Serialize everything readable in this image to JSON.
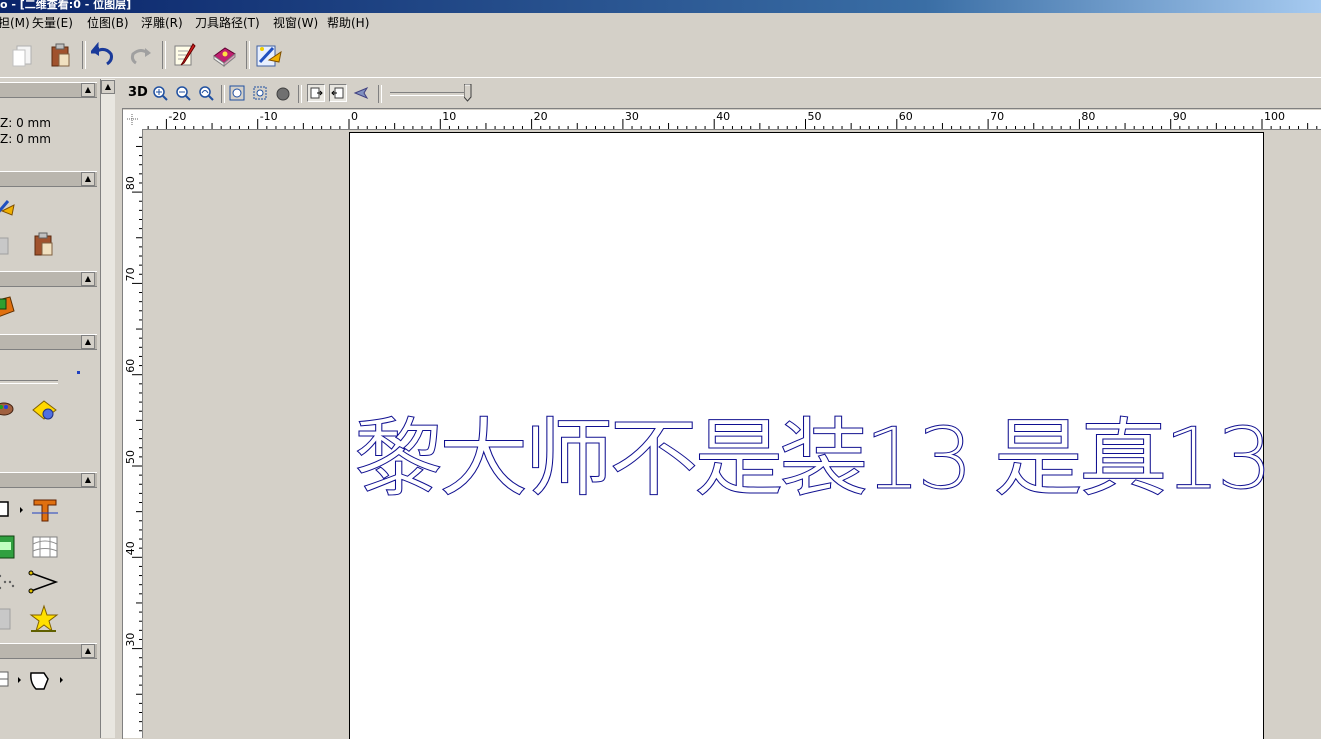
{
  "window": {
    "title": "o - [二维查看:0 - 位图层]"
  },
  "menu": {
    "items": [
      "担(M)",
      "矢量(E)",
      "位图(B)",
      "浮雕(R)",
      "刀具路径(T)",
      "视窗(W)",
      "帮助(H)"
    ]
  },
  "left_panel": {
    "coord_line1": "Z: 0 mm",
    "coord_line2": "Z: 0 mm"
  },
  "view_toolbar": {
    "label_3d": "3D"
  },
  "rulers": {
    "horizontal": [
      "-20",
      "-10",
      "0",
      "10",
      "20",
      "30",
      "40",
      "50",
      "60",
      "70",
      "80",
      "90",
      "100"
    ],
    "vertical": [
      "80",
      "70",
      "60",
      "50",
      "40",
      "30"
    ]
  },
  "canvas": {
    "text": "黎大师不是装13 是真13",
    "text_color": "#101090"
  }
}
